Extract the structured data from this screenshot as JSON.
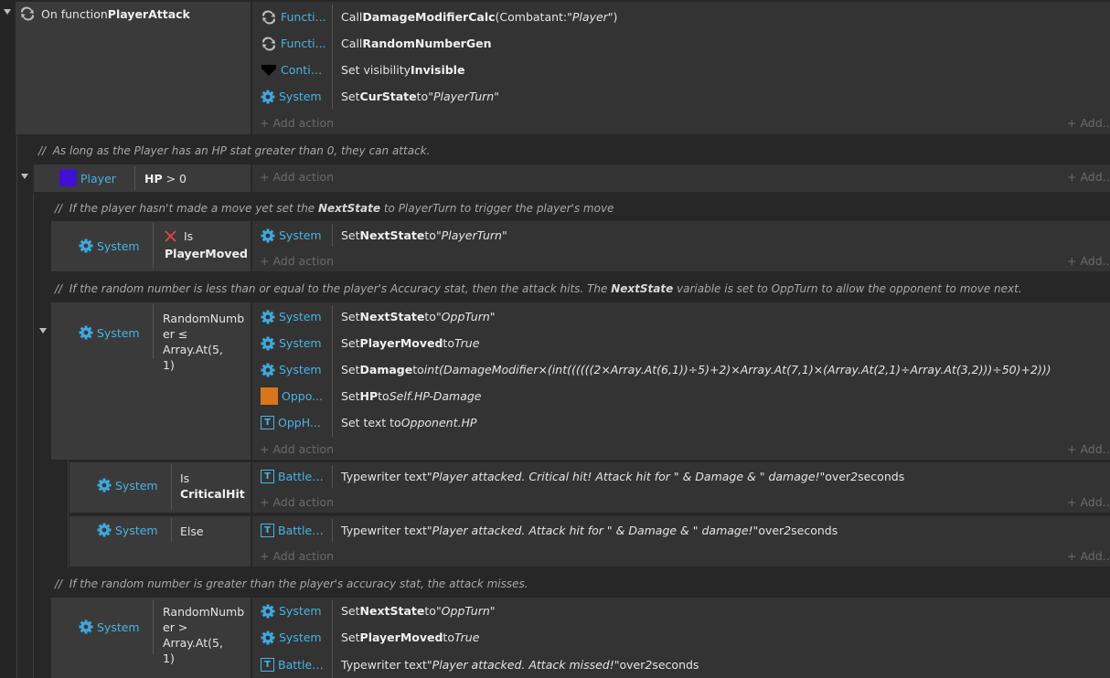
{
  "function_event": {
    "prefix": "On function ",
    "name": "PlayerAttack"
  },
  "ui": {
    "add_action": "+ Add action",
    "add_right": "+ Add..."
  },
  "top_actions": [
    {
      "object": "Functi...",
      "icon": "function-loop-icon",
      "pre": "Call ",
      "bold": "DamageModifierCalc",
      "mid": " (Combatant: ",
      "ital": "\"Player\"",
      "post": ")"
    },
    {
      "object": "Functi...",
      "icon": "function-loop-icon",
      "pre": "Call ",
      "bold": "RandomNumberGen",
      "mid": "",
      "ital": "",
      "post": ""
    },
    {
      "object": "Contin...",
      "icon": "continue-heart-icon",
      "pre": "Set visibility ",
      "bold": "Invisible",
      "mid": "",
      "ital": "",
      "post": ""
    },
    {
      "object": "System",
      "icon": "gear-icon",
      "pre": "Set ",
      "bold": "CurState",
      "mid": " to ",
      "ital": "\"PlayerTurn\"",
      "post": ""
    }
  ],
  "comment1": "As long as the Player has an HP stat greater than 0, they can attack.",
  "hp_event": {
    "object": "Player",
    "cond_bold": "HP",
    "cond_rest": " > 0",
    "color": "#3f12d1"
  },
  "comment2": {
    "pre": "If the player hasn't made a move yet set the ",
    "bold": "NextState",
    "post": " to PlayerTurn to trigger the player's move"
  },
  "moved_event": {
    "object": "System",
    "cond_is": "Is",
    "cond_bold": "PlayerMoved",
    "action": {
      "object": "System",
      "pre": "Set ",
      "bold": "NextState",
      "mid": " to ",
      "ital": "\"PlayerTurn\""
    }
  },
  "comment3": {
    "pre": "If the random number is less than or equal to the player's Accuracy stat, then the attack hits. The ",
    "bold": "NextState",
    "post": " variable is set to OppTurn to allow the opponent to move next."
  },
  "hit_event": {
    "object": "System",
    "cond_lines": [
      "RandomNumb",
      "er ≤ Array.At(5,",
      "1)"
    ],
    "actions": [
      {
        "object": "System",
        "icon": "gear-icon",
        "pre": "Set ",
        "bold": "NextState",
        "mid": " to ",
        "ital": "\"OppTurn\""
      },
      {
        "object": "System",
        "icon": "gear-icon",
        "pre": "Set ",
        "bold": "PlayerMoved",
        "mid": " to ",
        "ital": "True"
      },
      {
        "object": "System",
        "icon": "gear-icon",
        "pre": "Set ",
        "bold": "Damage",
        "mid": " to ",
        "ital": "int(DamageModifier×(int((((((2×Array.At(6,1))÷5)+2)×Array.At(7,1)×(Array.At(2,1)÷Array.At(3,2)))÷50)+2)))"
      },
      {
        "object": "Oppo...",
        "icon": "opponent-square-icon",
        "pre": "Set ",
        "bold": "HP",
        "mid": " to ",
        "ital": "Self.HP-Damage"
      },
      {
        "object": "OppH...",
        "icon": "text-object-icon",
        "pre": "Set text to ",
        "bold": "",
        "mid": "",
        "ital": "Opponent.HP"
      }
    ]
  },
  "crit_event": {
    "object": "System",
    "cond_is": "Is",
    "cond_bold": "CriticalHit",
    "action": {
      "object": "BattleT...",
      "pre": "Typewriter text ",
      "ital": "\"Player attacked. Critical hit! Attack hit for \" & Damage & \" damage!\"",
      "post_pre": " over ",
      "post_num": "2",
      "post_post": " seconds"
    }
  },
  "else_event": {
    "object": "System",
    "cond": "Else",
    "action": {
      "object": "BattleT...",
      "pre": "Typewriter text ",
      "ital": "\"Player attacked. Attack hit for \" & Damage & \" damage!\"",
      "post_pre": " over ",
      "post_num": "2",
      "post_post": " seconds"
    }
  },
  "comment4": "If the random number is greater than the player's accuracy stat, the attack misses.",
  "miss_event": {
    "object": "System",
    "cond_lines": [
      "RandomNumb",
      "er > Array.At(5,",
      "1)"
    ],
    "actions": [
      {
        "object": "System",
        "icon": "gear-icon",
        "pre": "Set ",
        "bold": "NextState",
        "mid": " to ",
        "ital": "\"OppTurn\""
      },
      {
        "object": "System",
        "icon": "gear-icon",
        "pre": "Set ",
        "bold": "PlayerMoved",
        "mid": " to ",
        "ital": "True"
      }
    ],
    "typewriter": {
      "object": "BattleT...",
      "pre": "Typewriter text ",
      "ital": "\"Player attacked. Attack missed!\"",
      "post_pre": " over ",
      "post_num": "2",
      "post_post": " seconds"
    }
  },
  "colors": {
    "link": "#48b3e5",
    "opponent": "#d9761c",
    "player": "#3f12d1",
    "x_red": "#e04848"
  }
}
